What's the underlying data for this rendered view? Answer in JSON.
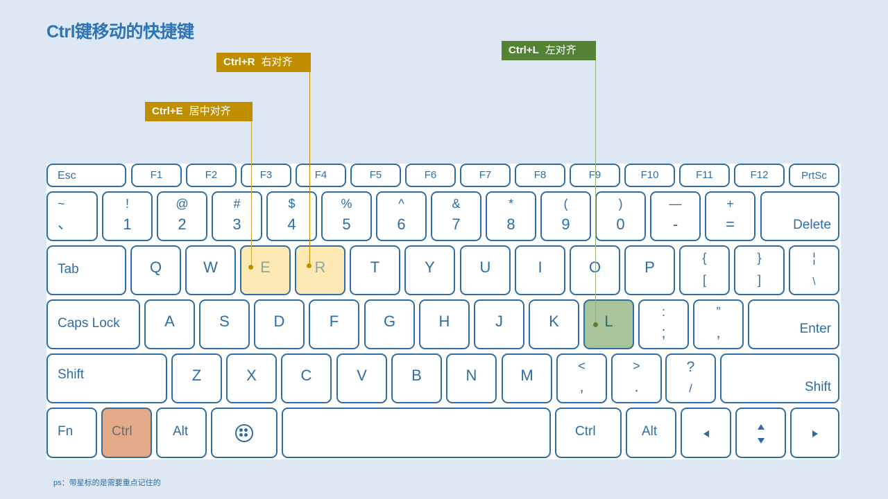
{
  "title": "Ctrl键移动的快捷键",
  "callouts": [
    {
      "key": "Ctrl+R",
      "desc": "右对齐",
      "color": "#bf8f00"
    },
    {
      "key": "Ctrl+E",
      "desc": "居中对齐",
      "color": "#bf8f00"
    },
    {
      "key": "Ctrl+L",
      "desc": "左对齐",
      "color": "#548235"
    }
  ],
  "keyboard": {
    "row0": [
      "Esc",
      "F1",
      "F2",
      "F3",
      "F4",
      "F5",
      "F6",
      "F7",
      "F8",
      "F9",
      "F10",
      "F11",
      "F12",
      "PrtSc"
    ],
    "row1": [
      {
        "top": "~",
        "bot": "、"
      },
      {
        "top": "!",
        "bot": "1"
      },
      {
        "top": "@",
        "bot": "2"
      },
      {
        "top": "#",
        "bot": "3"
      },
      {
        "top": "$",
        "bot": "4"
      },
      {
        "top": "%",
        "bot": "5"
      },
      {
        "top": "^",
        "bot": "6"
      },
      {
        "top": "&",
        "bot": "7"
      },
      {
        "top": "*",
        "bot": "8"
      },
      {
        "top": "(",
        "bot": "9"
      },
      {
        "top": ")",
        "bot": "0"
      },
      {
        "top": "—",
        "bot": "-"
      },
      {
        "top": "+",
        "bot": "="
      },
      {
        "label": "Delete"
      }
    ],
    "row2": [
      {
        "label": "Tab"
      },
      {
        "c": "Q"
      },
      {
        "c": "W"
      },
      {
        "c": "E"
      },
      {
        "c": "R"
      },
      {
        "c": "T"
      },
      {
        "c": "Y"
      },
      {
        "c": "U"
      },
      {
        "c": "I"
      },
      {
        "c": "O"
      },
      {
        "c": "P"
      },
      {
        "top": "{",
        "bot": "["
      },
      {
        "top": "}",
        "bot": "]"
      },
      {
        "top": "¦",
        "bot": "\\"
      }
    ],
    "row3": [
      {
        "label": "Caps Lock"
      },
      {
        "c": "A"
      },
      {
        "c": "S"
      },
      {
        "c": "D"
      },
      {
        "c": "F"
      },
      {
        "c": "G"
      },
      {
        "c": "H"
      },
      {
        "c": "J"
      },
      {
        "c": "K"
      },
      {
        "c": "L"
      },
      {
        "top": ":",
        "bot": ";"
      },
      {
        "top": "”",
        "bot": ","
      },
      {
        "label": "Enter"
      }
    ],
    "row4": [
      {
        "label": "Shift"
      },
      {
        "c": "Z"
      },
      {
        "c": "X"
      },
      {
        "c": "C"
      },
      {
        "c": "V"
      },
      {
        "c": "B"
      },
      {
        "c": "N"
      },
      {
        "c": "M"
      },
      {
        "top": "<",
        "bot": ","
      },
      {
        "top": ">",
        "bot": "."
      },
      {
        "top": "?",
        "bot": "/"
      },
      {
        "label": "Shift"
      }
    ],
    "row5": [
      {
        "label": "Fn"
      },
      {
        "label": "Ctrl"
      },
      {
        "label": "Alt"
      },
      {
        "icon": "menu-icon"
      },
      {
        "label": ""
      },
      {
        "label": "Ctrl"
      },
      {
        "label": "Alt"
      },
      {
        "icon": "arrow-left-icon"
      },
      {
        "icon": "arrow-up-down-icon"
      },
      {
        "icon": "arrow-right-icon"
      }
    ]
  },
  "highlights": {
    "E": "#fde9b3",
    "R": "#fde9b3",
    "L": "#a9c49a",
    "Ctrl-left": "#e2aa86"
  },
  "note": "ps：带星标的是需要重点记住的"
}
